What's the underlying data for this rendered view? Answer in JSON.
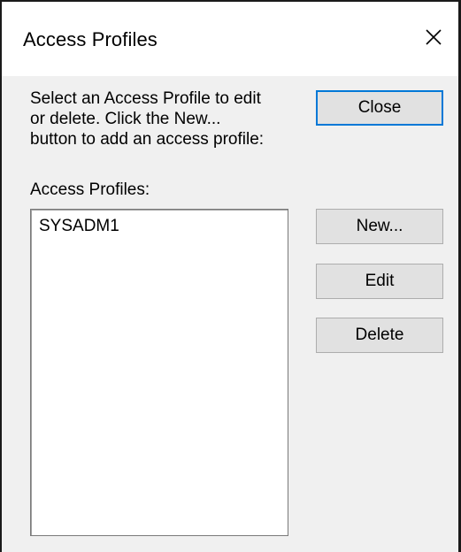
{
  "window": {
    "title": "Access Profiles",
    "close_icon": "close-x-icon"
  },
  "instructions": {
    "lines": [
      "Select an Access Profile to edit",
      "or delete.  Click the New...",
      "button to add an access profile:"
    ]
  },
  "list": {
    "label": "Access Profiles:",
    "items": [
      "SYSADM1"
    ]
  },
  "buttons": {
    "close_label": "Close",
    "new_label": "New...",
    "edit_label": "Edit",
    "delete_label": "Delete"
  },
  "colors": {
    "default_button_border": "#0078d7",
    "dialog_background": "#f0f0f0",
    "button_face": "#e1e1e1"
  }
}
